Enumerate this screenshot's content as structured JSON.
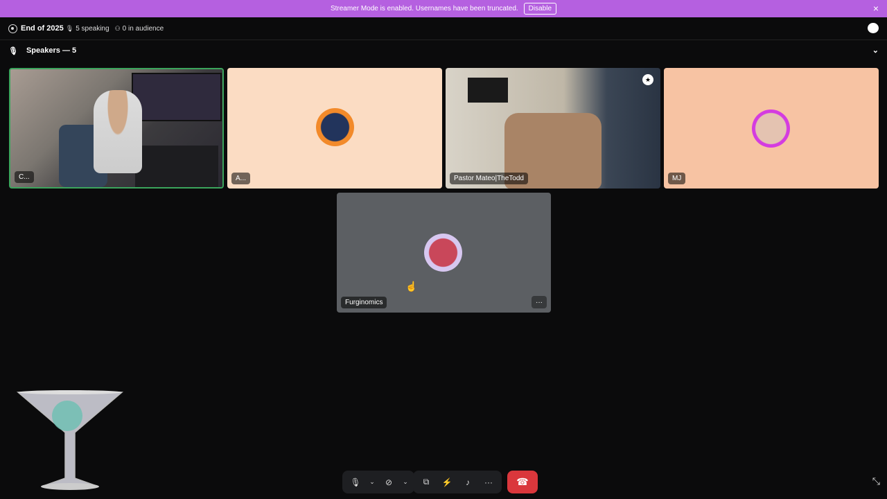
{
  "banner": {
    "message": "Streamer Mode is enabled. Usernames have been truncated.",
    "disable_label": "Disable",
    "close_icon": "×"
  },
  "header": {
    "title": "End of 2025",
    "speaking": "5 speaking",
    "audience": "0 in audience"
  },
  "speakers": {
    "label": "Speakers — 5"
  },
  "tiles": [
    {
      "name": "C..."
    },
    {
      "name": "A..."
    },
    {
      "name": "Pastor Mateo|TheTodd"
    },
    {
      "name": "MJ"
    },
    {
      "name": "Furginomics"
    }
  ],
  "controls": {
    "more_label": "···",
    "tile_more_label": "···"
  },
  "icons": {
    "mic": "🎙",
    "chevron": "⌄",
    "camera_off": "⊘",
    "screen_share": "⧉",
    "activity": "⚡",
    "soundboard": "♪",
    "hangup": "☎",
    "expand": "⤡",
    "cursor": "☝",
    "shield": "★"
  }
}
